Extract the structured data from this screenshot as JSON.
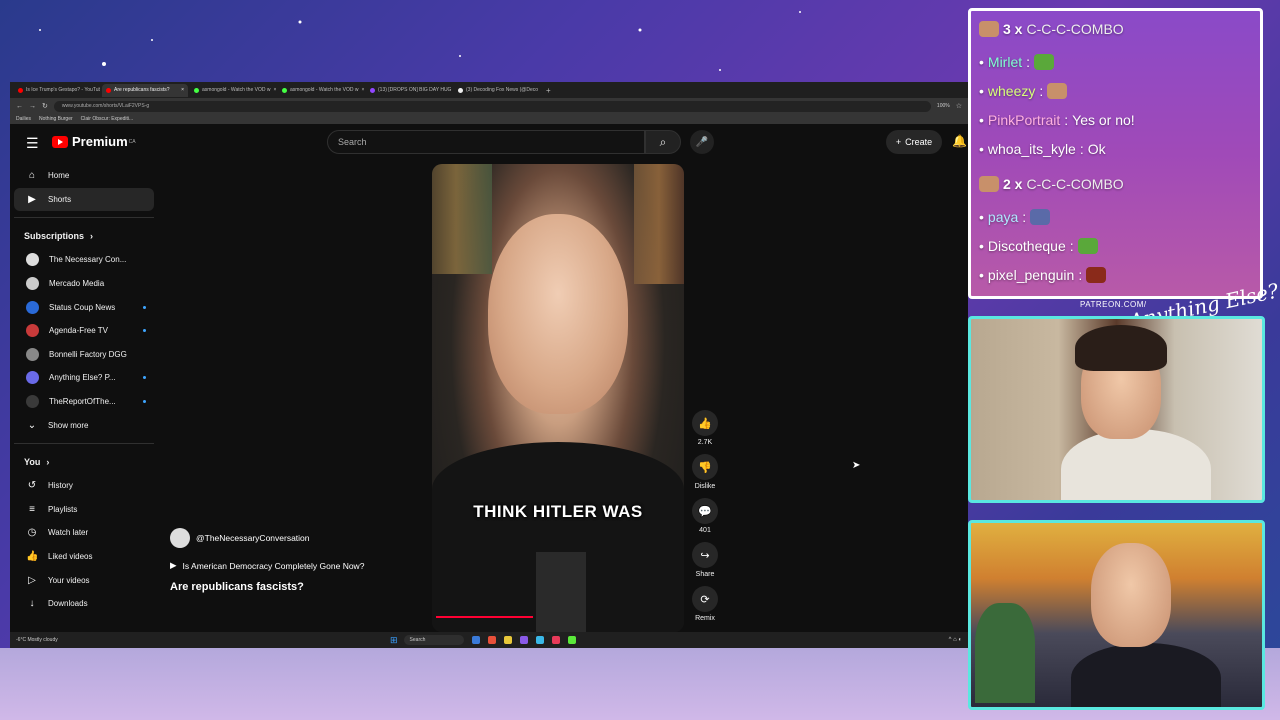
{
  "browser": {
    "tabs": [
      {
        "label": "Is Ice Trump's Gestapo? - YouTub",
        "color": "#ff0000",
        "active": false
      },
      {
        "label": "Are republicans fascists?",
        "color": "#ff0000",
        "active": true
      },
      {
        "label": "asmongold - Watch the VOD w",
        "color": "#44ff44",
        "active": false
      },
      {
        "label": "asmongold - Watch the VOD w",
        "color": "#44ff44",
        "active": false
      },
      {
        "label": "(13) [DROPS ON] BIG DAY HUG",
        "color": "#9146ff",
        "active": false
      },
      {
        "label": "(3) Decoding Fox News (@Deco",
        "color": "#eeeeee",
        "active": false
      }
    ],
    "url": "www.youtube.com/shorts/VLaiF2VPS-g",
    "zoom": "100%",
    "bookmarks": [
      "Dailies",
      "Nothing Burger",
      "Clair Obscur: Expediti..."
    ]
  },
  "youtube": {
    "logo_text": "Premium",
    "logo_sup": "CA",
    "search_placeholder": "Search",
    "create_label": "Create",
    "sidebar": {
      "primary": [
        {
          "icon": "⌂",
          "name": "home",
          "label": "Home",
          "active": false
        },
        {
          "icon": "▶",
          "name": "shorts",
          "label": "Shorts",
          "active": true
        }
      ],
      "subscriptions_header": "Subscriptions",
      "subscriptions": [
        {
          "label": "The Necessary Con...",
          "color": "#dddddd",
          "live": false
        },
        {
          "label": "Mercado Media",
          "color": "#cccccc",
          "live": false
        },
        {
          "label": "Status Coup News",
          "color": "#2a6ad8",
          "live": true
        },
        {
          "label": "Agenda-Free TV",
          "color": "#c83a3a",
          "live": true
        },
        {
          "label": "Bonnelli Factory DGG",
          "color": "#888888",
          "live": false
        },
        {
          "label": "Anything Else? P...",
          "color": "#6a6ae8",
          "live": true
        },
        {
          "label": "TheReportOfThe...",
          "color": "#3a3a3a",
          "live": true
        }
      ],
      "show_more": "Show more",
      "you_header": "You",
      "you_items": [
        {
          "icon": "↺",
          "name": "history",
          "label": "History"
        },
        {
          "icon": "≡",
          "name": "playlists",
          "label": "Playlists"
        },
        {
          "icon": "◷",
          "name": "watch-later",
          "label": "Watch later"
        },
        {
          "icon": "👍",
          "name": "liked-videos",
          "label": "Liked videos"
        },
        {
          "icon": "▷",
          "name": "your-videos",
          "label": "Your videos"
        },
        {
          "icon": "↓",
          "name": "downloads",
          "label": "Downloads"
        }
      ]
    },
    "short": {
      "caption": "THINK HITLER WAS",
      "channel": "@TheNecessaryConversation",
      "playlist": "Is American Democracy Completely Gone Now?",
      "title": "Are republicans fascists?",
      "progress": 0.6
    },
    "actions": [
      {
        "icon": "👍",
        "name": "like-button",
        "label": "2.7K"
      },
      {
        "icon": "👎",
        "name": "dislike-button",
        "label": "Dislike"
      },
      {
        "icon": "💬",
        "name": "comments-button",
        "label": "401"
      },
      {
        "icon": "↪",
        "name": "share-button",
        "label": "Share"
      },
      {
        "icon": "⟳",
        "name": "remix-button",
        "label": "Remix"
      }
    ]
  },
  "taskbar": {
    "weather_temp": "-6°C",
    "weather_desc": "Mostly cloudy",
    "search": "Search"
  },
  "chat": [
    {
      "type": "combo",
      "count": "3 x",
      "text": "C-C-C-COMBO"
    },
    {
      "type": "msg",
      "user": "Mirlet",
      "color": "#7fffd0",
      "text": "",
      "emote": "#5aa83a"
    },
    {
      "type": "msg",
      "user": "wheezy",
      "color": "#d8ff7a",
      "text": "",
      "emote": "#c8906a"
    },
    {
      "type": "msg",
      "user": "PinkPortrait",
      "color": "#ffb0e0",
      "text": "Yes or no!",
      "emote": ""
    },
    {
      "type": "msg",
      "user": "whoa_its_kyle",
      "color": "#ffffff",
      "text": "Ok",
      "emote": ""
    },
    {
      "type": "combo",
      "count": "2 x",
      "text": "C-C-C-COMBO"
    },
    {
      "type": "msg",
      "user": "paya",
      "color": "#b0e8ff",
      "text": "",
      "emote": "#5a6aa8"
    },
    {
      "type": "msg",
      "user": "Discotheque",
      "color": "#ffffff",
      "text": "",
      "emote": "#5aa83a"
    },
    {
      "type": "msg",
      "user": "pixel_penguin",
      "color": "#ffffff",
      "text": "",
      "emote": "#8a2a1a"
    }
  ],
  "overlay": {
    "patreon": "PATREON.COM/",
    "signature": "Anything Else?"
  }
}
